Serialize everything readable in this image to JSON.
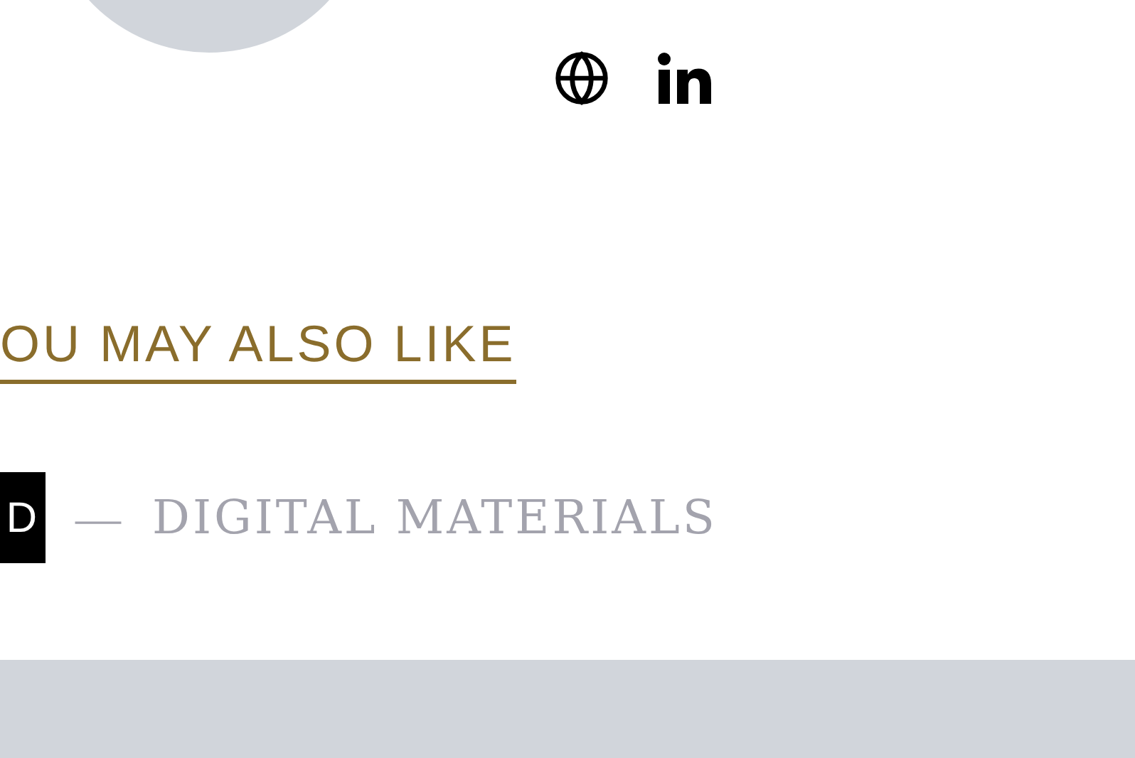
{
  "related": {
    "heading": "OU MAY ALSO LIKE"
  },
  "post": {
    "tag": "D",
    "dash": "—",
    "category": "DIGITAL MATERIALS"
  }
}
